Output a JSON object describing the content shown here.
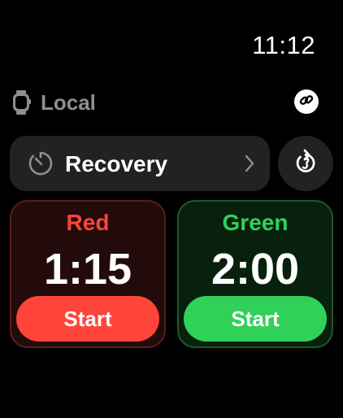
{
  "status_bar": {
    "time": "11:12"
  },
  "device": {
    "label": "Local",
    "icon": "watch-icon",
    "link_icon": "link-icon"
  },
  "workout": {
    "label": "Recovery",
    "icon": "timer-icon",
    "chevron": "chevron-right-icon"
  },
  "reset": {
    "icon": "reset-icon"
  },
  "timers": [
    {
      "name": "Red",
      "time": "1:15",
      "button_label": "Start",
      "accent": "#ff453a"
    },
    {
      "name": "Green",
      "time": "2:00",
      "button_label": "Start",
      "accent": "#30d158"
    }
  ],
  "colors": {
    "background": "#000000",
    "red": "#ff453a",
    "green": "#30d158",
    "muted": "#8e8e93"
  }
}
